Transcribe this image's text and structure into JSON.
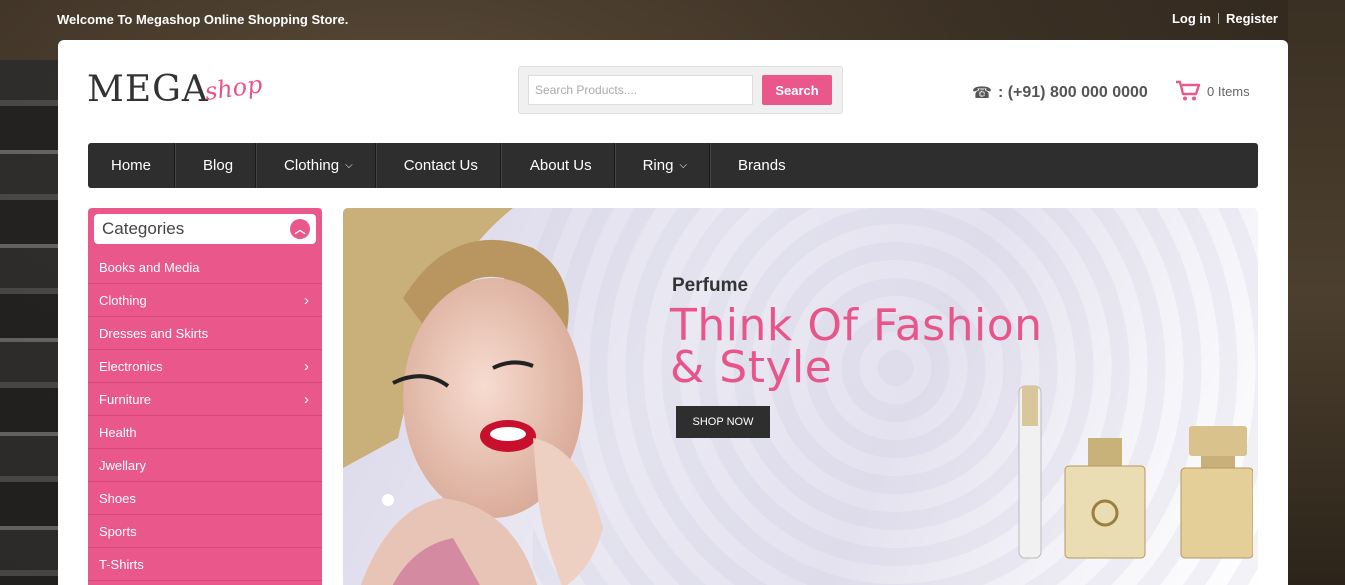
{
  "topbar": {
    "welcome": "Welcome To Megashop Online Shopping Store.",
    "login": "Log in",
    "register": "Register"
  },
  "logo": {
    "main": "MEGA",
    "accent": "shop"
  },
  "search": {
    "placeholder": "Search Products....",
    "button": "Search"
  },
  "contact": {
    "phone_icon": "phone-icon",
    "phone": ": (+91) 800 000 0000"
  },
  "cart": {
    "icon": "cart-icon",
    "label": "0 Items"
  },
  "nav": {
    "items": [
      {
        "label": "Home"
      },
      {
        "label": "Blog"
      },
      {
        "label": "Clothing",
        "caret": "⌄"
      },
      {
        "label": "Contact Us"
      },
      {
        "label": "About Us"
      },
      {
        "label": "Ring",
        "caret": "⌄"
      },
      {
        "label": "Brands"
      }
    ]
  },
  "categories": {
    "title": "Categories",
    "items": [
      {
        "label": "Books and Media"
      },
      {
        "label": "Clothing",
        "chevron": "›"
      },
      {
        "label": "Dresses and Skirts"
      },
      {
        "label": "Electronics",
        "chevron": "›"
      },
      {
        "label": "Furniture",
        "chevron": "›"
      },
      {
        "label": "Health"
      },
      {
        "label": "Jwellary"
      },
      {
        "label": "Shoes"
      },
      {
        "label": "Sports"
      },
      {
        "label": "T-Shirts"
      }
    ]
  },
  "banner": {
    "subtitle": "Perfume",
    "headline_line1": "Think Of Fashion",
    "headline_line2": "& Style",
    "cta": "SHOP NOW"
  },
  "colors": {
    "accent": "#ea578b",
    "nav_bg": "#2e2e2e"
  }
}
